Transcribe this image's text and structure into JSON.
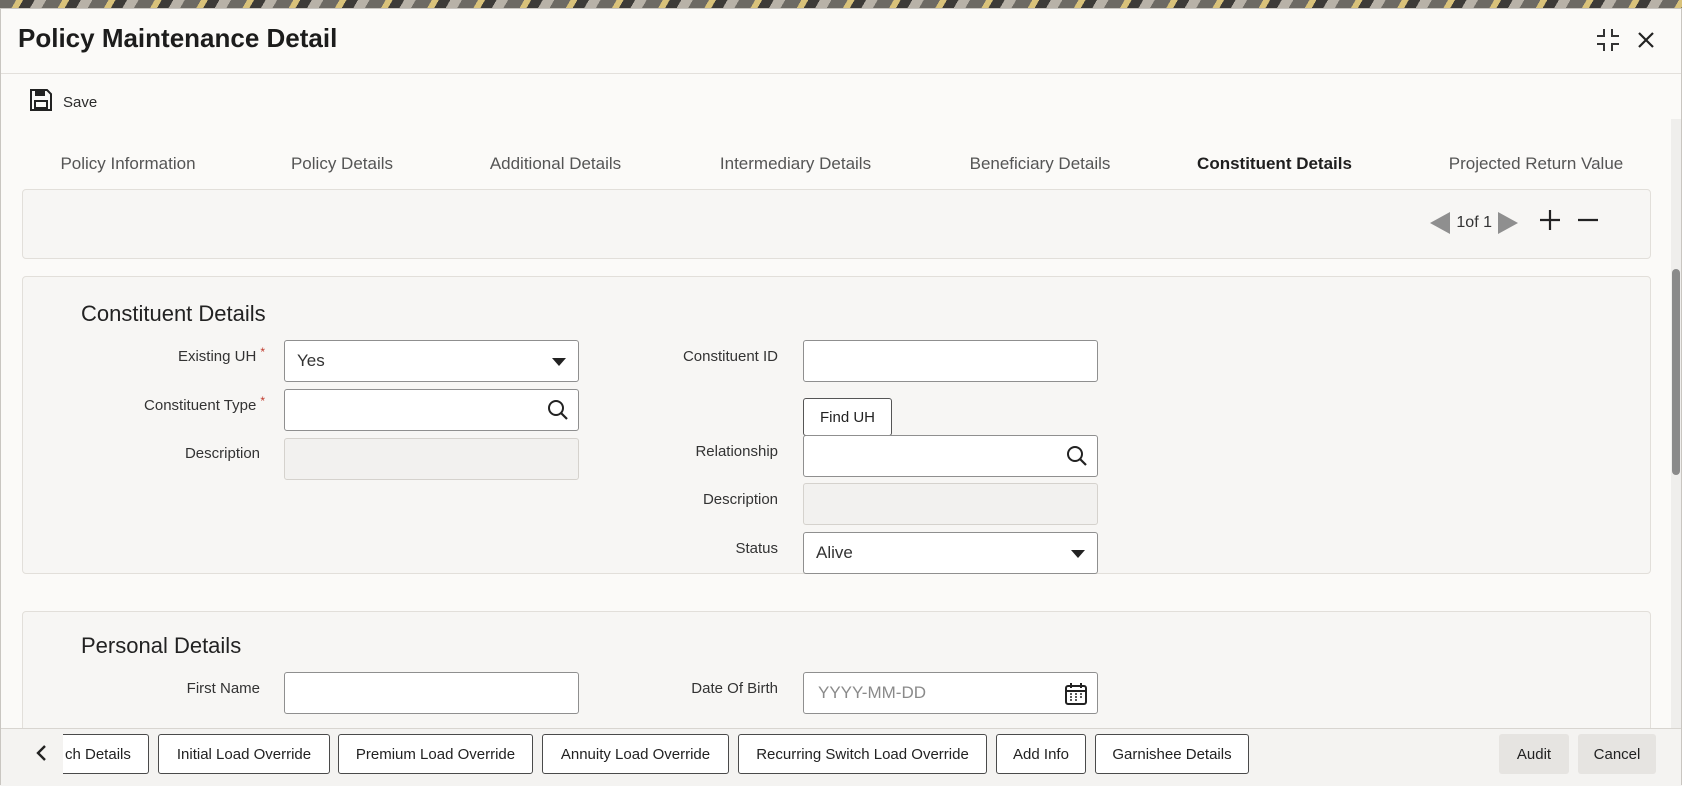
{
  "window": {
    "title": "Policy Maintenance Detail",
    "maximize_icon": "expand-icon",
    "close_icon": "close-icon"
  },
  "toolbar": {
    "save_label": "Save",
    "save_icon": "floppy-disk-icon"
  },
  "tabs": [
    {
      "label": "Policy Information",
      "active": false
    },
    {
      "label": "Policy Details",
      "active": false
    },
    {
      "label": "Additional Details",
      "active": false
    },
    {
      "label": "Intermediary Details",
      "active": false
    },
    {
      "label": "Beneficiary Details",
      "active": false
    },
    {
      "label": "Constituent Details",
      "active": true
    },
    {
      "label": "Projected Return Value",
      "active": false
    }
  ],
  "record_nav": {
    "pager_text": "1of 1",
    "add_icon": "plus-icon",
    "remove_icon": "minus-icon"
  },
  "constituent": {
    "section_title": "Constituent Details",
    "existing_uh": {
      "label": "Existing UH",
      "value": "Yes",
      "required": true
    },
    "constituent_type": {
      "label": "Constituent Type",
      "value": "",
      "required": true
    },
    "description": {
      "label": "Description",
      "value": ""
    },
    "constituent_id": {
      "label": "Constituent ID",
      "value": ""
    },
    "find_uh_label": "Find UH",
    "relationship": {
      "label": "Relationship",
      "value": ""
    },
    "description2": {
      "label": "Description",
      "value": ""
    },
    "status": {
      "label": "Status",
      "value": "Alive"
    },
    "required_mark": "*"
  },
  "personal": {
    "section_title": "Personal Details",
    "first_name": {
      "label": "First Name",
      "value": ""
    },
    "date_of_birth": {
      "label": "Date Of Birth",
      "placeholder": "YYYY-MM-DD"
    }
  },
  "footer": {
    "buttons": [
      "ch Details",
      "Initial Load Override",
      "Premium Load Override",
      "Annuity Load Override",
      "Recurring Switch Load Override",
      "Add Info",
      "Garnishee Details"
    ],
    "audit_label": "Audit",
    "cancel_label": "Cancel"
  }
}
